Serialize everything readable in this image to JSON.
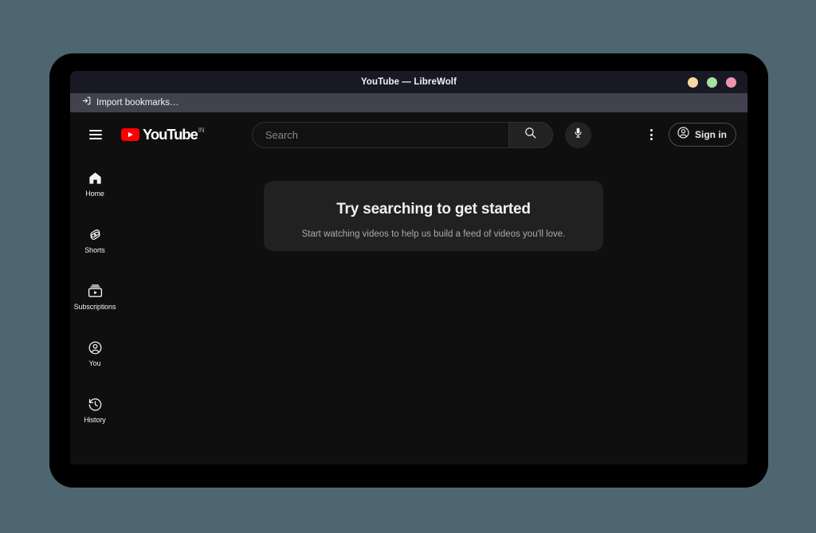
{
  "window": {
    "title": "YouTube — LibreWolf",
    "controls": [
      {
        "name": "minimize",
        "color": "#f5d9a0"
      },
      {
        "name": "maximize",
        "color": "#a8e0a0"
      },
      {
        "name": "close",
        "color": "#f093b0"
      }
    ]
  },
  "bookmarks_bar": {
    "items": [
      {
        "icon": "import-icon",
        "label": "Import bookmarks…"
      }
    ]
  },
  "masthead": {
    "guide_button": "guide-menu-icon",
    "logo": {
      "word": "YouTube",
      "country_code": "IN",
      "badge_color": "#ff0000"
    },
    "search": {
      "value": "",
      "placeholder": "Search",
      "search_button_icon": "search-icon",
      "voice_button_icon": "microphone-icon"
    },
    "settings_icon": "kebab-menu-icon",
    "sign_in": {
      "label": "Sign in",
      "icon": "account-circle-icon"
    }
  },
  "sidebar": {
    "items": [
      {
        "label": "Home",
        "icon": "home-icon"
      },
      {
        "label": "Shorts",
        "icon": "shorts-icon"
      },
      {
        "label": "Subscriptions",
        "icon": "subscriptions-icon"
      },
      {
        "label": "You",
        "icon": "account-circle-icon"
      },
      {
        "label": "History",
        "icon": "history-icon"
      }
    ]
  },
  "main": {
    "promo_card": {
      "title": "Try searching to get started",
      "subtitle": "Start watching videos to help us build a feed of videos you'll love."
    }
  },
  "theme": {
    "page_background": "#4e6670",
    "bezel": "#000000",
    "titlebar": "#191925",
    "bookmarks_bar": "#42424f",
    "app_background": "#0f0f0f",
    "card_background": "#212121",
    "accent_red": "#ff0000"
  }
}
